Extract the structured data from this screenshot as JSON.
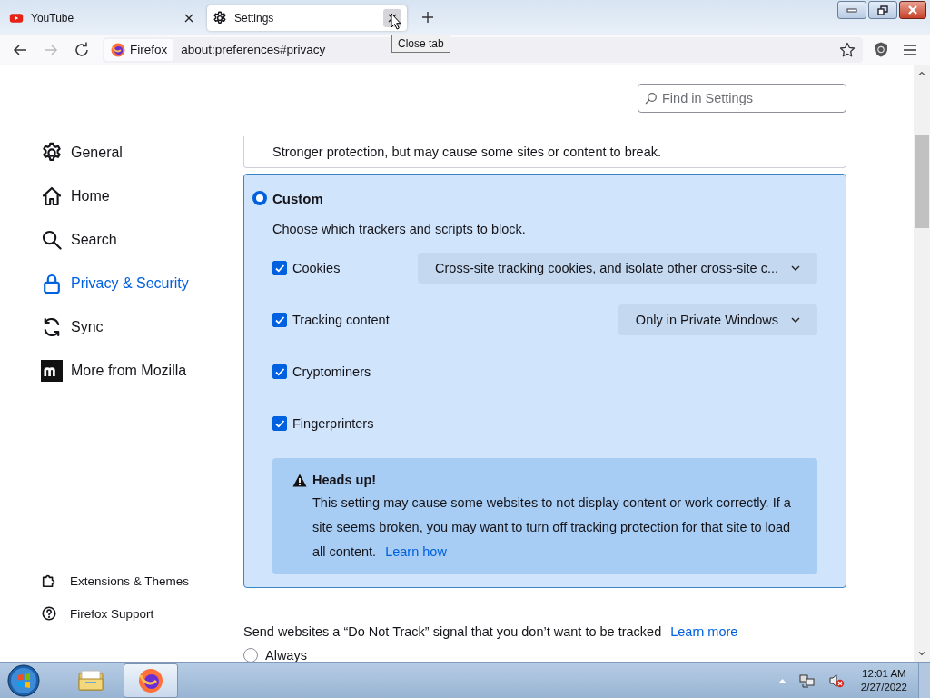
{
  "tabs": [
    {
      "label": "YouTube",
      "kind": "youtube",
      "selected": false
    },
    {
      "label": "Settings",
      "kind": "gear",
      "selected": true
    }
  ],
  "tooltip": "Close tab",
  "toolbar": {
    "identity": "Firefox",
    "url": "about:preferences#privacy"
  },
  "search": {
    "placeholder": "Find in Settings"
  },
  "sidebar": {
    "items": [
      {
        "label": "General",
        "kind": "gear",
        "selected": false
      },
      {
        "label": "Home",
        "kind": "home",
        "selected": false
      },
      {
        "label": "Search",
        "kind": "search",
        "selected": false
      },
      {
        "label": "Privacy & Security",
        "kind": "lock",
        "selected": true
      },
      {
        "label": "Sync",
        "kind": "sync",
        "selected": false
      },
      {
        "label": "More from Mozilla",
        "kind": "mozilla",
        "selected": false
      }
    ],
    "footer": [
      {
        "label": "Extensions & Themes",
        "kind": "puzzle"
      },
      {
        "label": "Firefox Support",
        "kind": "help"
      }
    ]
  },
  "strict_card": {
    "description": "Stronger protection, but may cause some sites or content to break."
  },
  "custom": {
    "label": "Custom",
    "selected": true,
    "description": "Choose which trackers and scripts to block.",
    "options": [
      {
        "label": "Cookies",
        "checked": true,
        "dropdown": "Cross-site tracking cookies, and isolate other cross-site c..."
      },
      {
        "label": "Tracking content",
        "checked": true,
        "dropdown": "Only in Private Windows"
      },
      {
        "label": "Cryptominers",
        "checked": true
      },
      {
        "label": "Fingerprinters",
        "checked": true
      }
    ],
    "warning": {
      "title": "Heads up!",
      "text": "This setting may cause some websites to not display content or work correctly. If a site seems broken, you may want to turn off tracking protection for that site to load all content.",
      "link": "Learn how"
    }
  },
  "dnt": {
    "text": "Send websites a “Do Not Track” signal that you don’t want to be tracked",
    "link": "Learn more",
    "options": [
      {
        "label": "Always",
        "selected": false
      }
    ]
  },
  "taskbar": {
    "apps": [
      {
        "kind": "explorer",
        "selected": false
      },
      {
        "kind": "firefox",
        "selected": true
      }
    ],
    "time": "12:01 AM",
    "date": "2/27/2022"
  }
}
